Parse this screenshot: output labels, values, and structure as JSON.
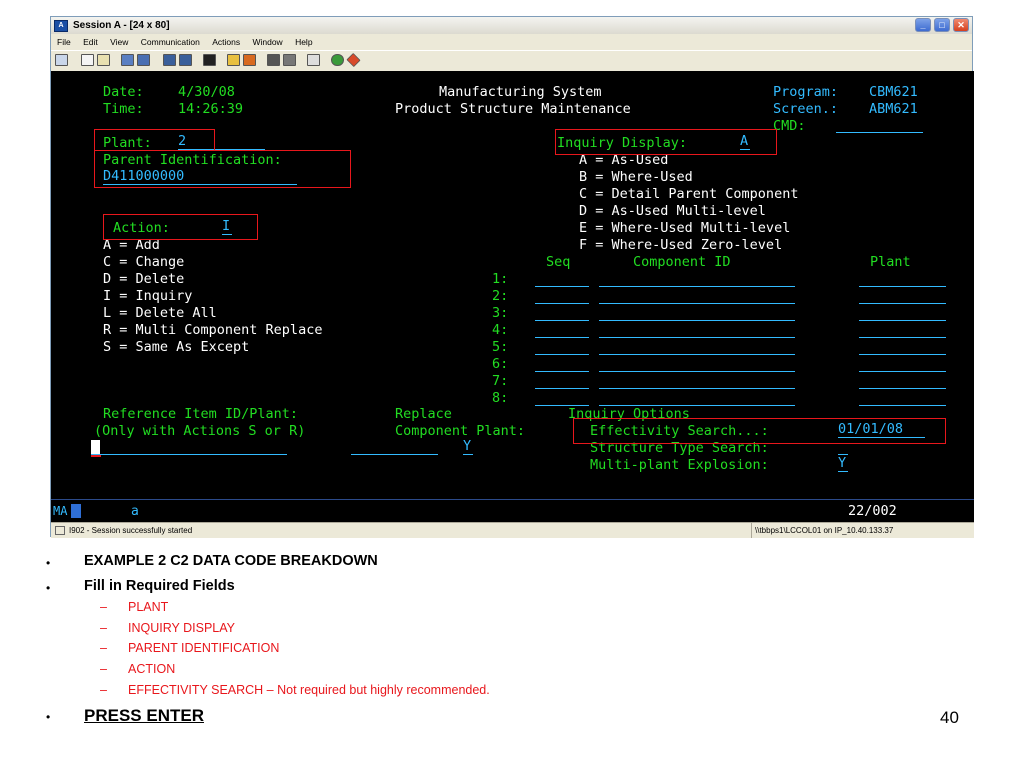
{
  "window": {
    "title": "Session A - [24 x 80]",
    "menu": [
      "File",
      "Edit",
      "View",
      "Communication",
      "Actions",
      "Window",
      "Help"
    ]
  },
  "screen": {
    "date_label": "Date:",
    "date": "4/30/08",
    "time_label": "Time:",
    "time": "14:26:39",
    "system_title": "Manufacturing System",
    "subtitle": "Product Structure Maintenance",
    "program_label": "Program:",
    "program": "CBM621",
    "screen_label": "Screen.:",
    "screen_id": "ABM621",
    "cmd_label": "CMD:",
    "cmd_value": "",
    "plant_label": "Plant:",
    "plant_value": "2",
    "parent_label": "Parent Identification:",
    "parent_value": "D411000000",
    "inquiry_label": "Inquiry Display:",
    "inquiry_value": "A",
    "inquiry_options": [
      "A = As-Used",
      "B = Where-Used",
      "C = Detail Parent Component",
      "D = As-Used Multi-level",
      "E = Where-Used Multi-level",
      "F = Where-Used Zero-level"
    ],
    "action_label": "Action:",
    "action_value": "I",
    "action_options": [
      "A = Add",
      "C = Change",
      "D = Delete",
      "I = Inquiry",
      "L = Delete All",
      "R = Multi Component Replace",
      "S = Same As Except"
    ],
    "seq_header": "Seq",
    "component_header": "Component ID",
    "plant_header": "Plant",
    "row_numbers": [
      "1:",
      "2:",
      "3:",
      "4:",
      "5:",
      "6:",
      "7:",
      "8:"
    ],
    "ref_label": "Reference Item ID/Plant:",
    "ref_note": "(Only with Actions S or R)",
    "replace_label": "Replace",
    "component_plant_label": "Component Plant:",
    "replace_value": "Y",
    "inquiry_options_title": "Inquiry Options",
    "effectivity_label": "Effectivity Search...:",
    "effectivity_value": "01/01/08",
    "structure_label": "Structure Type Search:",
    "multiplant_label": "Multi-plant Explosion:",
    "multiplant_value": "Y"
  },
  "oia": {
    "mode": "MA",
    "indicator": "a",
    "cursor_pos": "22/002"
  },
  "status": {
    "message": "I902 - Session successfully started",
    "connection": "\\\\tbbps1\\LCCOL01 on IP_10.40.133.37"
  },
  "slide": {
    "bullet1": "EXAMPLE 2  C2 DATA CODE BREAKDOWN",
    "bullet2": "Fill in Required Fields",
    "subitems": [
      "PLANT",
      "INQUIRY DISPLAY",
      "PARENT IDENTIFICATION",
      "ACTION",
      "EFFECTIVITY SEARCH – Not required but highly recommended."
    ],
    "bullet3": "PRESS ENTER",
    "page_number": "40"
  },
  "colors": {
    "terminal_bg": "#000000",
    "field_text": "#33bbff",
    "label_text": "#22dd22",
    "highlight_box": "#e8171c"
  }
}
